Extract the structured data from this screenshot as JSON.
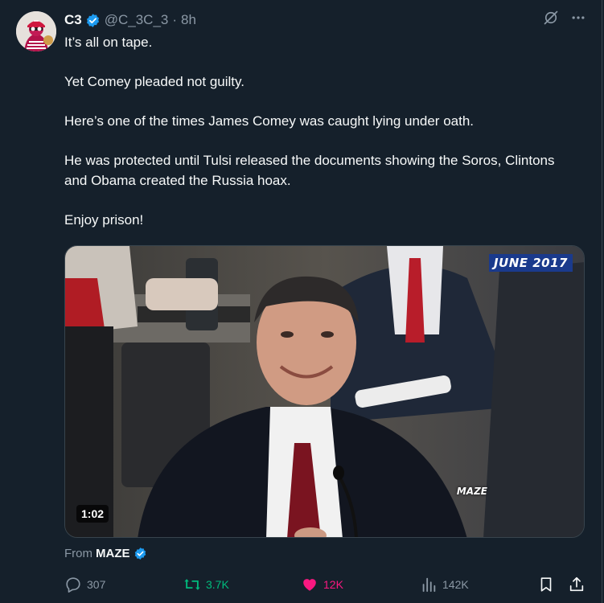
{
  "post": {
    "author_name": "C3",
    "handle": "@C_3C_3",
    "separator": "·",
    "time": "8h",
    "paragraphs": [
      "It’s all on tape.",
      "Yet Comey pleaded not guilty.",
      "Here’s one of the times James Comey was caught lying under oath.",
      "He was protected until Tulsi released the documents showing the Soros, Clintons and Obama created the Russia hoax.",
      "Enjoy prison!"
    ]
  },
  "media": {
    "date_overlay": "JUNE 2017",
    "watermark": "MAZE",
    "duration": "1:02"
  },
  "source": {
    "prefix": "From",
    "name": "MAZE"
  },
  "actions": {
    "replies": "307",
    "reposts": "3.7K",
    "likes": "12K",
    "views": "142K"
  },
  "icons": {
    "verified": "verified-badge-icon",
    "grok": "grok-icon",
    "more": "more-icon",
    "reply": "reply-icon",
    "repost": "repost-icon",
    "like": "heart-icon",
    "views": "views-icon",
    "bookmark": "bookmark-icon",
    "share": "share-icon"
  },
  "colors": {
    "background": "#15202b",
    "text": "#f7f9f9",
    "muted": "#8b98a5",
    "verified": "#1d9bf0",
    "repost_active": "#00ba7c",
    "like_active": "#f91880"
  }
}
